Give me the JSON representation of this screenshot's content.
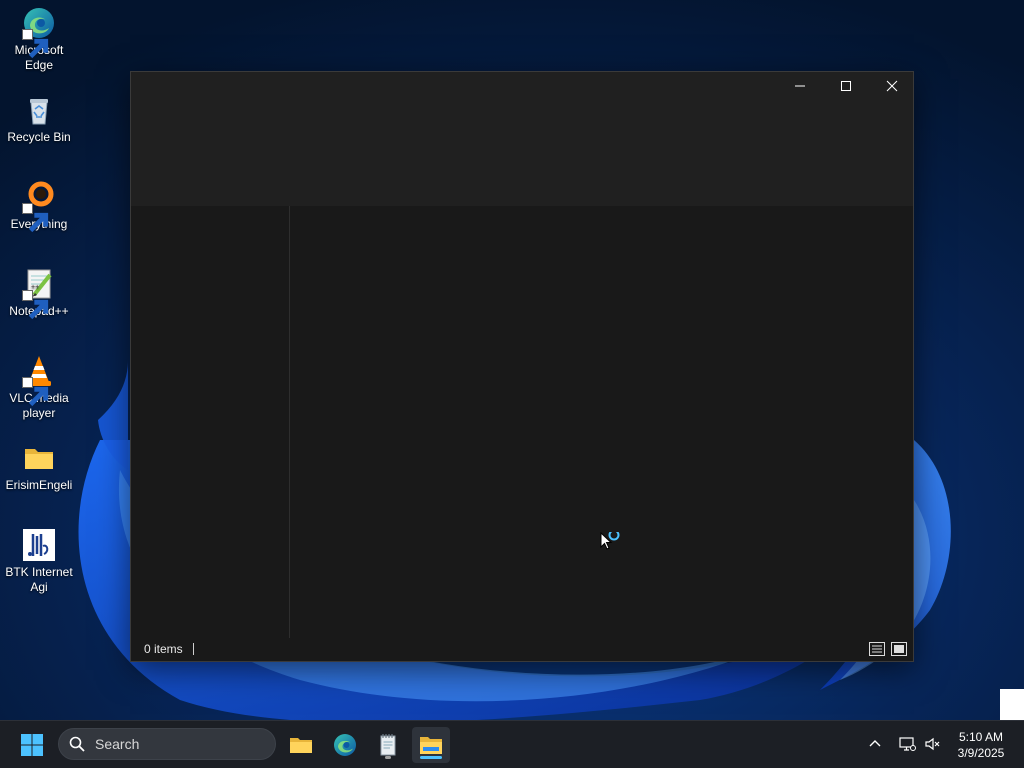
{
  "desktop": {
    "icons": [
      {
        "label": "Microsoft Edge",
        "icon": "edge-icon"
      },
      {
        "label": "Recycle Bin",
        "icon": "recycle-bin-icon"
      },
      {
        "label": "Everything",
        "icon": "everything-icon"
      },
      {
        "label": "Notepad++",
        "icon": "notepad-plus-plus-icon"
      },
      {
        "label": "VLC media player",
        "icon": "vlc-icon"
      },
      {
        "label": "ErisimEngeli",
        "icon": "folder-icon"
      },
      {
        "label": "BTK Internet Agi",
        "icon": "btk-icon"
      }
    ]
  },
  "explorer": {
    "status_count": "0 items",
    "caption_buttons": [
      "minimize",
      "maximize",
      "close"
    ],
    "view_buttons": [
      "details-view",
      "large-icons-view"
    ]
  },
  "taskbar": {
    "search_placeholder": "Search",
    "pinned": [
      {
        "name": "file-explorer",
        "icon": "folder-icon"
      },
      {
        "name": "edge",
        "icon": "edge-icon"
      },
      {
        "name": "notepad",
        "icon": "notepad-icon"
      },
      {
        "name": "file-explorer-active",
        "icon": "explorer-icon"
      }
    ],
    "tray": {
      "time": "5:10 AM",
      "date": "3/9/2025"
    }
  },
  "colors": {
    "accent": "#4cc2ff",
    "window_bg": "#191919",
    "title_bg": "#202020",
    "taskbar_bg": "#1c1f25"
  }
}
